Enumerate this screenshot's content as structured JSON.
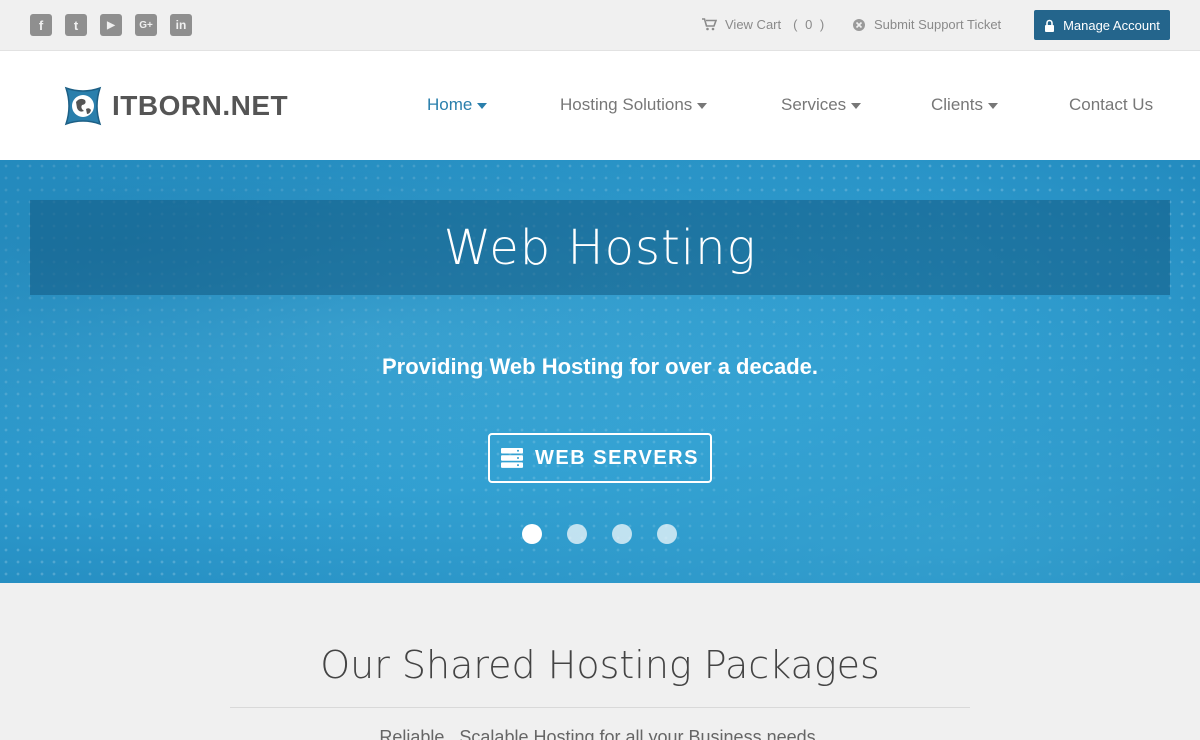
{
  "topbar": {
    "social": [
      {
        "name": "facebook-icon",
        "glyph": "f"
      },
      {
        "name": "twitter-icon",
        "glyph": "t"
      },
      {
        "name": "youtube-icon",
        "glyph": "▶"
      },
      {
        "name": "google-plus-icon",
        "glyph": "G+"
      },
      {
        "name": "linkedin-icon",
        "glyph": "in"
      }
    ],
    "cart_label": "View Cart",
    "cart_count": "( 0 )",
    "ticket_label": "Submit Support Ticket",
    "manage_label": "Manage Account"
  },
  "header": {
    "logo_text": "ITBORN.NET",
    "nav": [
      {
        "label": "Home",
        "caret": true,
        "active": true
      },
      {
        "label": "Hosting Solutions",
        "caret": true
      },
      {
        "label": "Services",
        "caret": true
      },
      {
        "label": "Clients",
        "caret": true
      },
      {
        "label": "Contact Us",
        "caret": false
      }
    ]
  },
  "hero": {
    "title": "Web Hosting",
    "subtitle": "Providing Web Hosting for over a decade.",
    "button_label": "WEB SERVERS",
    "slides": 4,
    "active_slide": 1
  },
  "section": {
    "title": "Our Shared Hosting Packages",
    "subtitle": "Reliable , Scalable Hosting for all your Business needs."
  },
  "colors": {
    "accent": "#24658c",
    "nav_active": "#2a7fac",
    "hero": "#2f9dd0"
  }
}
